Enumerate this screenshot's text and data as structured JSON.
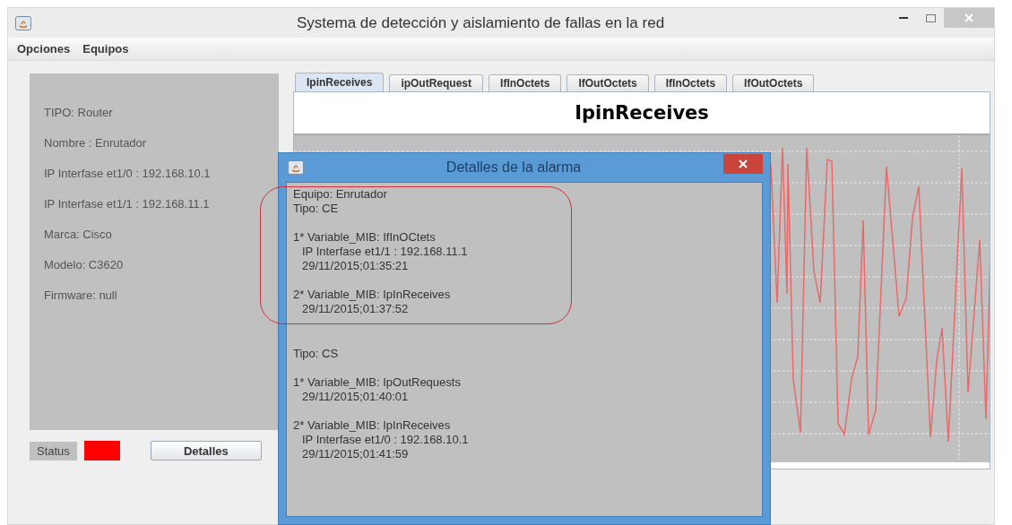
{
  "window": {
    "title": "Systema de detección y aislamiento de fallas en la red"
  },
  "menu": [
    "Opciones",
    "Equipos"
  ],
  "device_panel": {
    "lines": [
      "TIPO: Router",
      "Nombre : Enrutador",
      "IP Interfase et1/0 : 192.168.10.1",
      "IP Interfase et1/1 : 192.168.11.1",
      "Marca: Cisco",
      "Modelo: C3620",
      "Firmware: null"
    ]
  },
  "status": {
    "label": "Status",
    "color": "#ff0000"
  },
  "details_button": "Detalles",
  "tabs": [
    {
      "label": "IpinReceives",
      "selected": true
    },
    {
      "label": "ipOutRequest",
      "selected": false
    },
    {
      "label": "IfInOctets",
      "selected": false
    },
    {
      "label": "IfOutOctets",
      "selected": false
    },
    {
      "label": "IfInOctets",
      "selected": false
    },
    {
      "label": "IfOutOctets",
      "selected": false
    }
  ],
  "chart": {
    "title": "IpinReceives"
  },
  "dialog": {
    "title": "Detalles de la alarma",
    "groups": [
      {
        "highlighted": true,
        "blocks": [
          [
            {
              "text": "Equipo: Enrutador",
              "kind": "head"
            },
            {
              "text": "Tipo: CE",
              "kind": "head"
            }
          ],
          [
            {
              "text": "1* Variable_MIB: IfInOCtets",
              "kind": "head"
            },
            {
              "text": "IP Interfase et1/1 : 192.168.11.1",
              "kind": "detail"
            },
            {
              "text": "29/11/2015;01:35:21",
              "kind": "detail"
            }
          ],
          [
            {
              "text": "2* Variable_MIB: IpInReceives",
              "kind": "head"
            },
            {
              "text": "29/11/2015;01:37:52",
              "kind": "detail"
            }
          ]
        ]
      },
      {
        "highlighted": false,
        "blocks": [
          [
            {
              "text": "Tipo: CS",
              "kind": "head"
            }
          ],
          [
            {
              "text": "1* Variable_MIB: IpOutRequests",
              "kind": "head"
            },
            {
              "text": "29/11/2015;01:40:01",
              "kind": "detail"
            }
          ],
          [
            {
              "text": "2* Variable_MIB: IpInReceives",
              "kind": "head"
            },
            {
              "text": "IP Interfase et1/0 : 192.168.10.1",
              "kind": "detail"
            },
            {
              "text": "29/11/2015;01:41:59",
              "kind": "detail"
            }
          ]
        ]
      }
    ]
  }
}
